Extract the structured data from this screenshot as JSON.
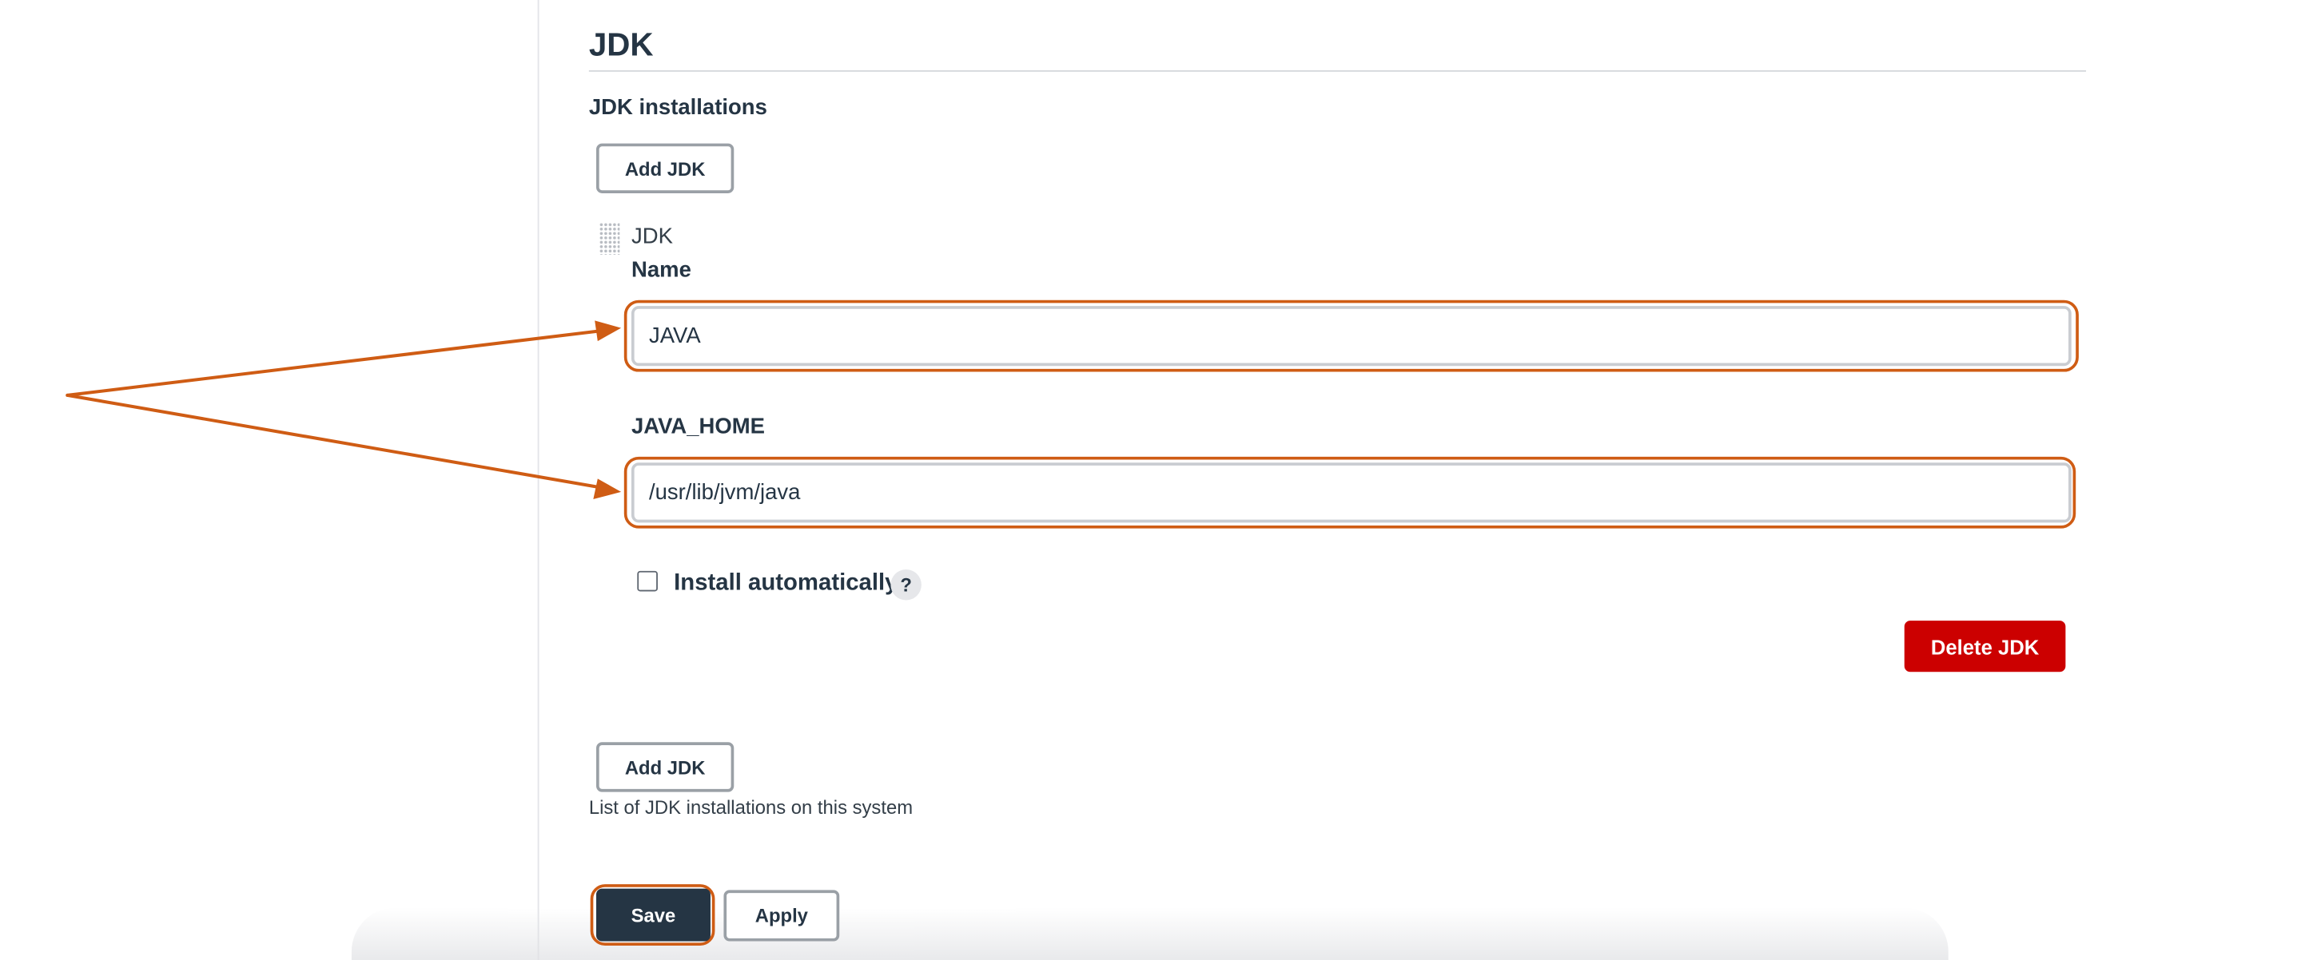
{
  "section": {
    "title": "JDK"
  },
  "installations": {
    "heading": "JDK installations",
    "add_button_label": "Add JDK",
    "help_text": "List of JDK installations on this system"
  },
  "jdk_item": {
    "title": "JDK",
    "name_label": "Name",
    "name_value": "JAVA",
    "java_home_label": "JAVA_HOME",
    "java_home_value": "/usr/lib/jvm/java",
    "install_auto_label": "Install automatically",
    "install_auto_checked": false,
    "help_glyph": "?",
    "delete_button_label": "Delete JDK"
  },
  "actions": {
    "save_label": "Save",
    "apply_label": "Apply"
  },
  "annotation": {
    "highlight_color": "#cf5c14"
  },
  "colors": {
    "primary_button": "#253544",
    "danger_button": "#cc0000",
    "text": "#253544"
  },
  "icons": {
    "drag_handle": "drag-handle-icon",
    "help": "help-icon",
    "arrows": "annotation-arrow-icon"
  }
}
